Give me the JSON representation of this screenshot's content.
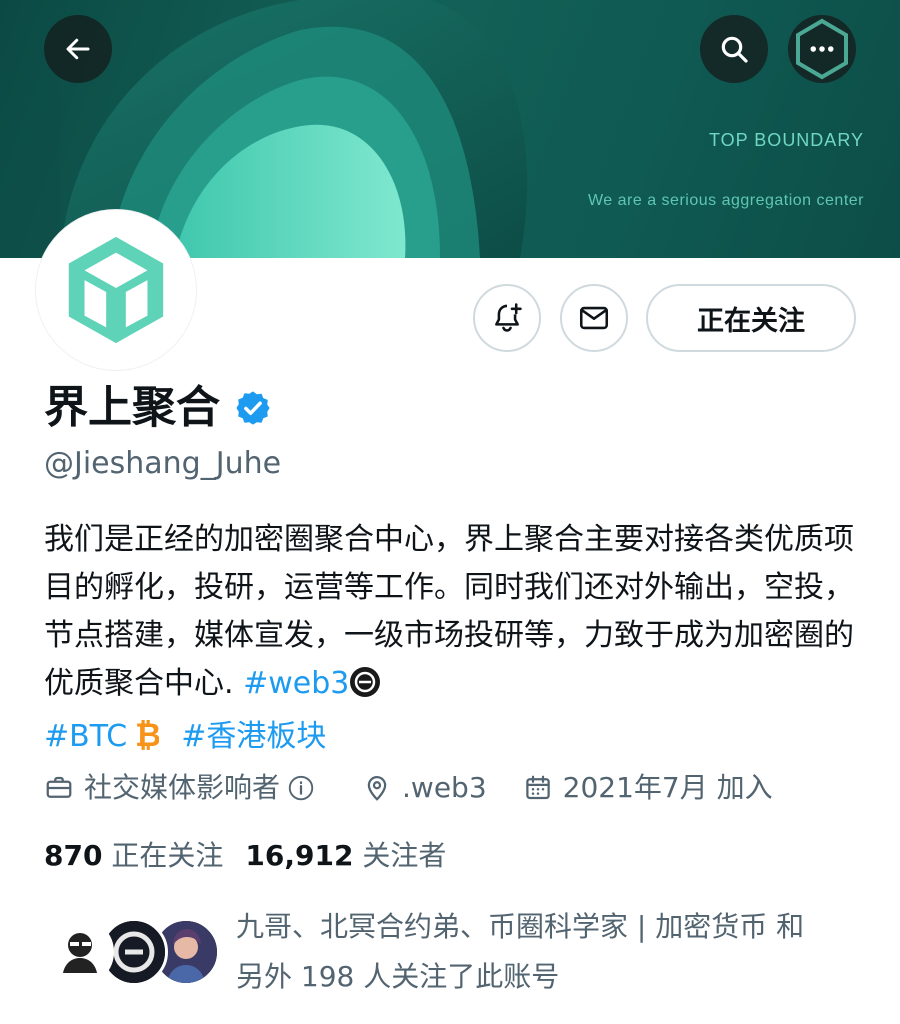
{
  "banner": {
    "title": "TOP BOUNDARY",
    "tagline": "We are a serious aggregation center"
  },
  "profile": {
    "display_name": "界上聚合",
    "handle": "@Jieshang_Juhe",
    "follow_button": "正在关注",
    "bio_text": "我们是正经的加密圈聚合中心，界上聚合主要对接各类优质项目的孵化，投研，运营等工作。同时我们还对外输出，空投，节点搭建，媒体宣发，一级市场投研等，力致于成为加密圈的优质聚合中心. ",
    "bio_tags": [
      "#web3",
      "#BTC",
      "#香港板块"
    ]
  },
  "meta": {
    "category": "社交媒体影响者",
    "location": ".web3",
    "joined": "2021年7月 加入"
  },
  "stats": {
    "following_count": "870",
    "following_label": "正在关注",
    "followers_count": "16,912",
    "followers_label": "关注者"
  },
  "followers_you_know": {
    "line1": "九哥、北冥合约弟、币圈科学家 | 加密货币 和",
    "line2": "另外 198 人关注了此账号"
  },
  "colors": {
    "accent": "#1d9bf0",
    "brand_teal": "#5fd3b8",
    "banner_dark": "#0f5a53"
  },
  "icons": {
    "back": "arrow-left-icon",
    "search": "search-icon",
    "more": "more-horizontal-icon",
    "notify": "bell-plus-icon",
    "message": "mail-icon",
    "verified": "verified-badge-icon",
    "category": "briefcase-icon",
    "location": "location-pin-icon",
    "joined": "calendar-icon"
  }
}
